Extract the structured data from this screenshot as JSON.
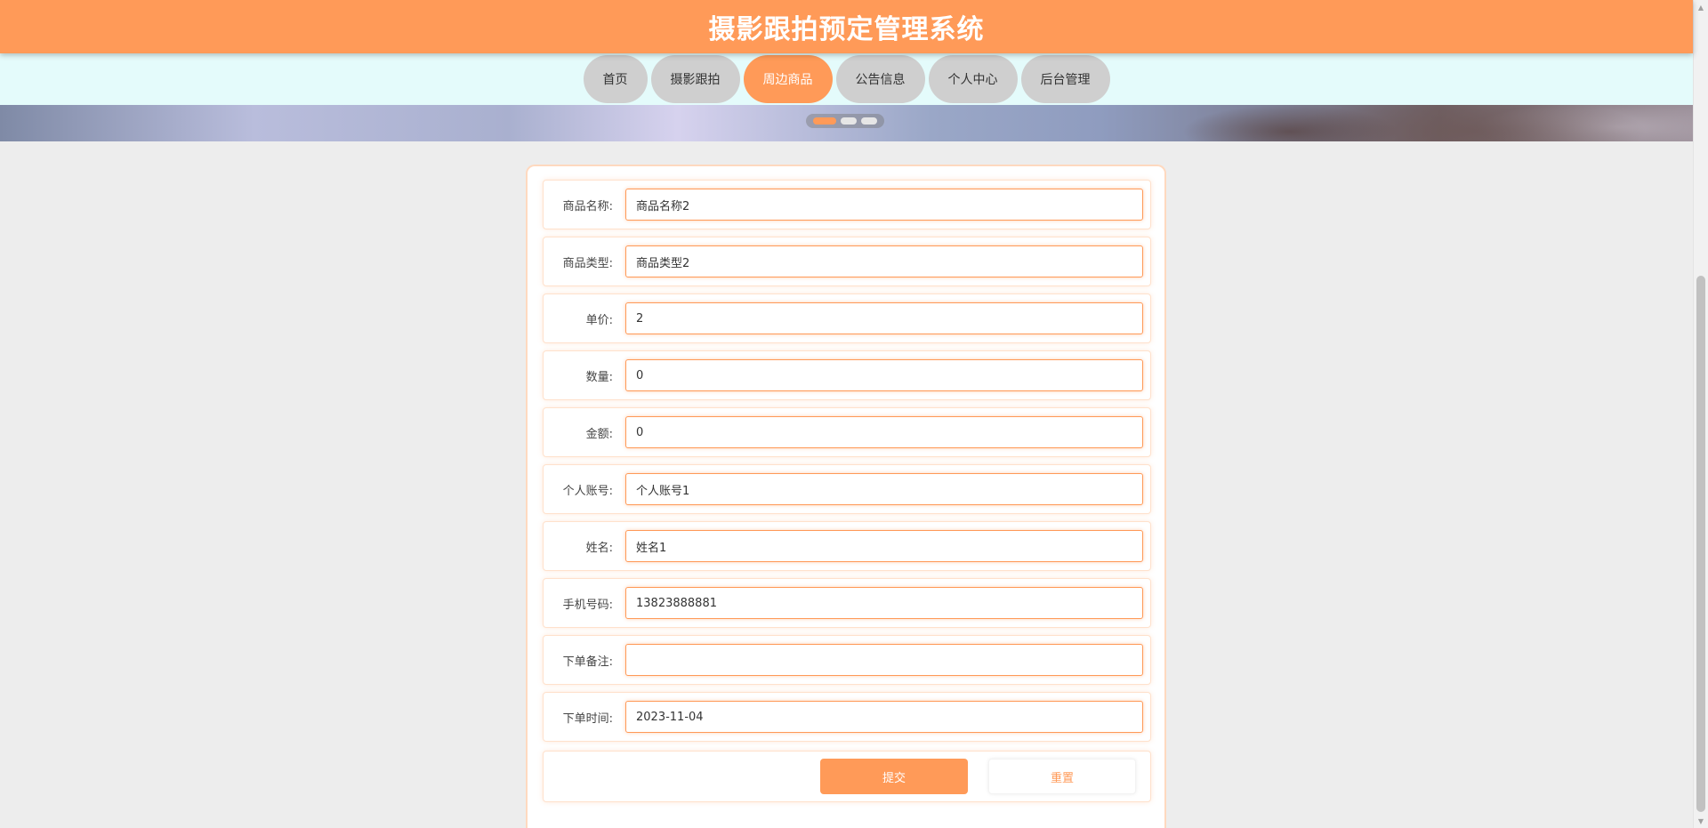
{
  "header": {
    "title": "摄影跟拍预定管理系统"
  },
  "nav": {
    "items": [
      {
        "label": "首页"
      },
      {
        "label": "摄影跟拍"
      },
      {
        "label": "周边商品",
        "active": true
      },
      {
        "label": "公告信息"
      },
      {
        "label": "个人中心"
      },
      {
        "label": "后台管理"
      }
    ]
  },
  "carousel": {
    "slide_count": 3,
    "active_index": 0
  },
  "form": {
    "fields": [
      {
        "label": "商品名称:",
        "value": "商品名称2"
      },
      {
        "label": "商品类型:",
        "value": "商品类型2"
      },
      {
        "label": "单价:",
        "value": "2"
      },
      {
        "label": "数量:",
        "value": "0"
      },
      {
        "label": "金额:",
        "value": "0"
      },
      {
        "label": "个人账号:",
        "value": "个人账号1"
      },
      {
        "label": "姓名:",
        "value": "姓名1"
      },
      {
        "label": "手机号码:",
        "value": "13823888881"
      },
      {
        "label": "下单备注:",
        "value": ""
      },
      {
        "label": "下单时间:",
        "value": "2023-11-04"
      }
    ],
    "submit_label": "提交",
    "reset_label": "重置"
  },
  "colors": {
    "accent": "#ff9a58",
    "nav_bg": "#e4fbfb",
    "nav_item": "#cfcfcf",
    "page_bg": "#ededed"
  }
}
